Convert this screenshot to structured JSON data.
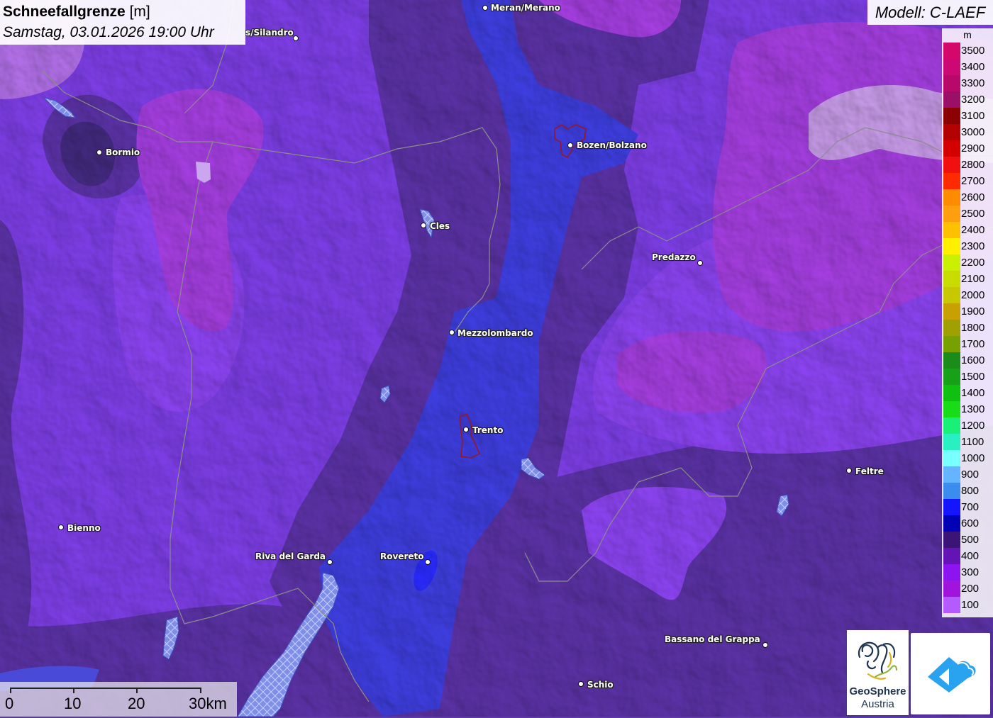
{
  "header": {
    "title_bold": "Schneefallgrenze",
    "title_unit": "[m]",
    "date": "Samstag, 03.01.2026 19:00 Uhr"
  },
  "model": "Modell: C-LAEF",
  "legend": {
    "unit": "m",
    "items": [
      {
        "label": "3500",
        "color": "#d4086a"
      },
      {
        "label": "3400",
        "color": "#cc0875"
      },
      {
        "label": "3300",
        "color": "#b8086a"
      },
      {
        "label": "3200",
        "color": "#9a0f68"
      },
      {
        "label": "3100",
        "color": "#8b0000"
      },
      {
        "label": "3000",
        "color": "#b40000"
      },
      {
        "label": "2900",
        "color": "#d40000"
      },
      {
        "label": "2800",
        "color": "#f01010"
      },
      {
        "label": "2700",
        "color": "#ff2a00"
      },
      {
        "label": "2600",
        "color": "#ff8c00"
      },
      {
        "label": "2500",
        "color": "#ff9f10"
      },
      {
        "label": "2400",
        "color": "#ffc000"
      },
      {
        "label": "2300",
        "color": "#fff000"
      },
      {
        "label": "2200",
        "color": "#c8f000"
      },
      {
        "label": "2100",
        "color": "#c8dc00"
      },
      {
        "label": "2000",
        "color": "#c8c800"
      },
      {
        "label": "1900",
        "color": "#c8a000"
      },
      {
        "label": "1800",
        "color": "#a0a000"
      },
      {
        "label": "1700",
        "color": "#78a000"
      },
      {
        "label": "1600",
        "color": "#1a8c1a"
      },
      {
        "label": "1500",
        "color": "#18a018"
      },
      {
        "label": "1400",
        "color": "#10c010"
      },
      {
        "label": "1300",
        "color": "#18dc18"
      },
      {
        "label": "1200",
        "color": "#18f078"
      },
      {
        "label": "1100",
        "color": "#28f0c0"
      },
      {
        "label": "1000",
        "color": "#78ffff"
      },
      {
        "label": "900",
        "color": "#64b4ff"
      },
      {
        "label": "800",
        "color": "#3c8cf0"
      },
      {
        "label": "700",
        "color": "#1414ff"
      },
      {
        "label": "600",
        "color": "#0000b4"
      },
      {
        "label": "500",
        "color": "#3c1478"
      },
      {
        "label": "400",
        "color": "#6414b4"
      },
      {
        "label": "300",
        "color": "#8c14f0"
      },
      {
        "label": "200",
        "color": "#a014dc"
      },
      {
        "label": "100",
        "color": "#b45aff"
      }
    ]
  },
  "cities": [
    {
      "name": "Meran/Merano"
    },
    {
      "name": "s/Silandro"
    },
    {
      "name": "Bormio"
    },
    {
      "name": "Bozen/Bolzano"
    },
    {
      "name": "Cles"
    },
    {
      "name": "Predazzo"
    },
    {
      "name": "Mezzolombardo"
    },
    {
      "name": "Trento"
    },
    {
      "name": "Feltre"
    },
    {
      "name": "Bienno"
    },
    {
      "name": "Riva del Garda"
    },
    {
      "name": "Rovereto"
    },
    {
      "name": "Bassano del Grappa"
    },
    {
      "name": "Schio"
    }
  ],
  "scale_bar": {
    "labels": [
      "0",
      "10",
      "20",
      "30km"
    ]
  },
  "logo": {
    "line1": "GeoSphere",
    "line2": "Austria"
  }
}
